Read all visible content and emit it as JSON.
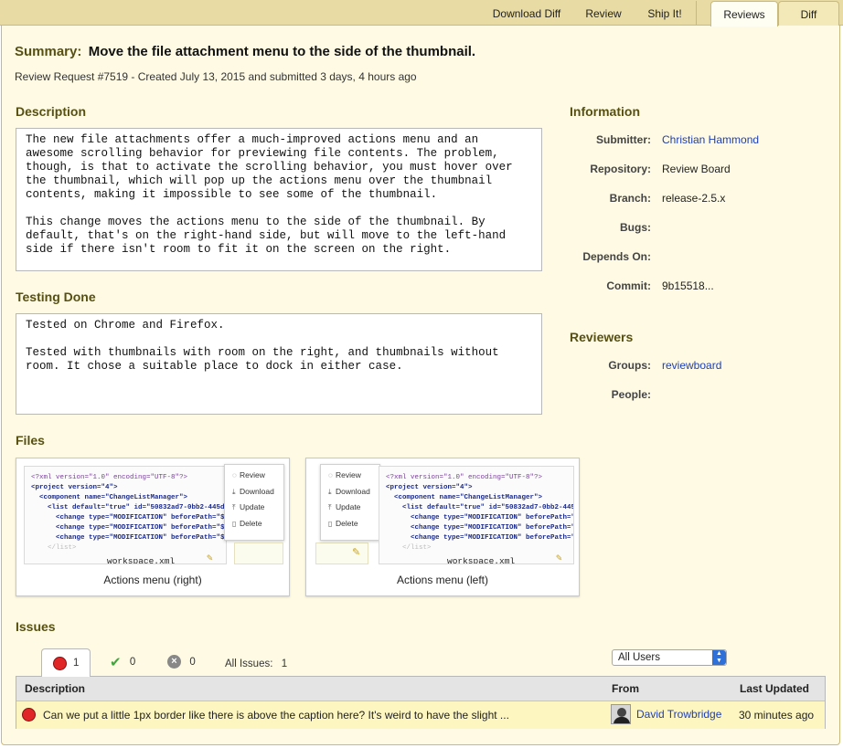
{
  "actions": {
    "download_diff": "Download Diff",
    "review": "Review",
    "ship_it": "Ship It!"
  },
  "tabs": [
    {
      "label": "Reviews",
      "active": true
    },
    {
      "label": "Diff",
      "active": false
    }
  ],
  "summary": {
    "label": "Summary:",
    "text": "Move the file attachment menu to the side of the thumbnail."
  },
  "request_meta": "Review Request #7519 - Created July 13, 2015 and submitted 3 days, 4 hours ago",
  "description": {
    "heading": "Description",
    "text": "The new file attachments offer a much-improved actions menu and an awesome scrolling behavior for previewing file contents. The problem, though, is that to activate the scrolling behavior, you must hover over the thumbnail, which will pop up the actions menu over the thumbnail contents, making it impossible to see some of the thumbnail.\n\nThis change moves the actions menu to the side of the thumbnail. By default, that's on the right-hand side, but will move to the left-hand side if there isn't room to fit it on the screen on the right."
  },
  "testing_done": {
    "heading": "Testing Done",
    "text": "Tested on Chrome and Firefox.\n\nTested with thumbnails with room on the right, and thumbnails without room. It chose a suitable place to dock in either case."
  },
  "information": {
    "heading": "Information",
    "fields": [
      {
        "label": "Submitter:",
        "value": "Christian Hammond",
        "link": true
      },
      {
        "label": "Repository:",
        "value": "Review Board",
        "link": false
      },
      {
        "label": "Branch:",
        "value": "release-2.5.x",
        "link": false
      },
      {
        "label": "Bugs:",
        "value": "",
        "link": false
      },
      {
        "label": "Depends On:",
        "value": "",
        "link": false
      },
      {
        "label": "Commit:",
        "value": "9b15518...",
        "link": false
      }
    ]
  },
  "reviewers": {
    "heading": "Reviewers",
    "fields": [
      {
        "label": "Groups:",
        "value": "reviewboard",
        "link": true
      },
      {
        "label": "People:",
        "value": "",
        "link": false
      }
    ]
  },
  "files": {
    "heading": "Files",
    "items": [
      {
        "caption": "Actions menu (right)",
        "filename": "workspace.xml"
      },
      {
        "caption": "Actions menu (left)",
        "filename": "workspace.xml"
      }
    ],
    "menu_items": [
      "Review",
      "Download",
      "Update",
      "Delete"
    ],
    "code_lines": [
      "<?xml version=\"1.0\" encoding=\"UTF-8\"?>",
      "<project version=\"4\">",
      "  <component name=\"ChangeListManager\">",
      "    <list default=\"true\" id=\"50832ad7-0bb2-445d-",
      "      <change type=\"MODIFICATION\" beforePath=\"$P",
      "      <change type=\"MODIFICATION\" beforePath=\"$P",
      "      <change type=\"MODIFICATION\" beforePath=\"$P",
      "    </list>"
    ]
  },
  "issues": {
    "heading": "Issues",
    "open_count": "1",
    "resolved_count": "0",
    "dropped_count": "0",
    "all_label": "All Issues:",
    "all_count": "1",
    "filter_selected": "All Users",
    "columns": {
      "description": "Description",
      "from": "From",
      "last_updated": "Last Updated"
    },
    "rows": [
      {
        "description": "Can we put a little 1px border like there is above the caption here? It's weird to have the slight ...",
        "from": "David Trowbridge",
        "last_updated": "30 minutes ago"
      }
    ]
  },
  "colors": {
    "heading": "#575012",
    "panel_bg": "#fefae3",
    "bar_bg": "#e8dba3",
    "link": "#1f3fb4",
    "open_issue": "#e02626",
    "issue_row_bg": "#fdf6c0"
  }
}
